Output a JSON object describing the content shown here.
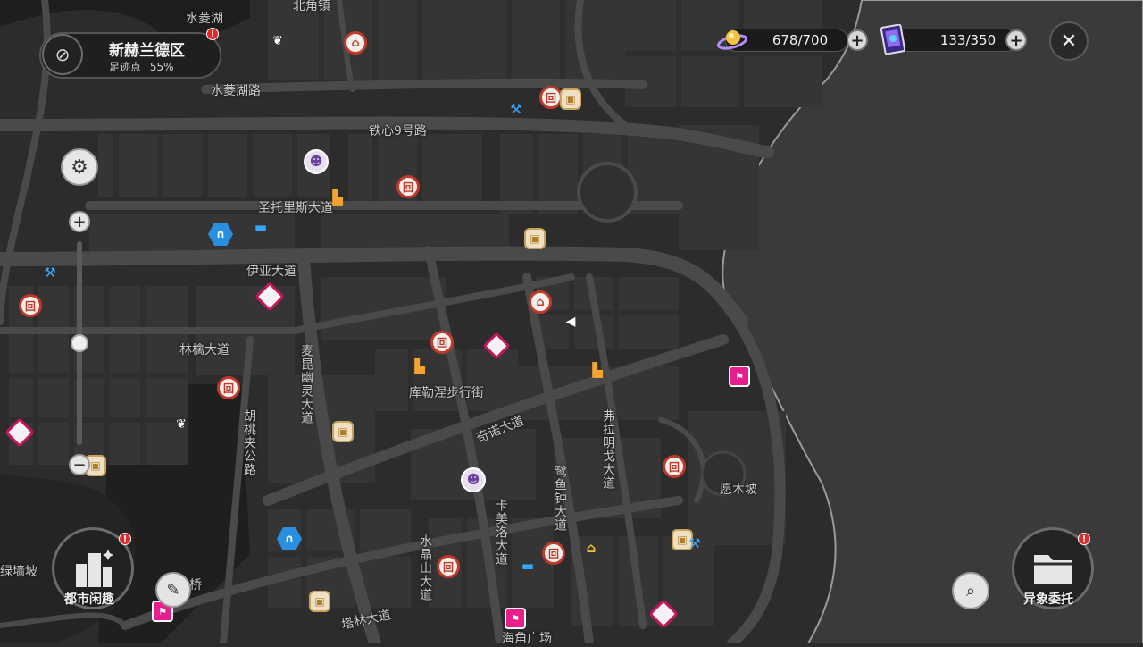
{
  "hud": {
    "district": {
      "name": "新赫兰德区",
      "progress_label": "足迹点",
      "progress_value": "55%"
    },
    "resources": [
      {
        "id": "energy",
        "value": "678/700",
        "icon": "energy-orb-icon"
      },
      {
        "id": "cards",
        "value": "133/350",
        "icon": "card-pack-icon"
      }
    ],
    "alert_mark": "!"
  },
  "bottom_left": {
    "city_fun_label": "都市闲趣"
  },
  "bottom_right": {
    "anomaly_label": "异象委托"
  },
  "map": {
    "labels": {
      "shuiling_lake": "水菱湖",
      "beijiao_town": "北角镇",
      "shuiling_lake_road": "水菱湖路",
      "tiexin_road": "铁心9号路",
      "santorius_ave": "圣托里斯大道",
      "yiya_ave": "伊亚大道",
      "linqin_ave": "林檎大道",
      "kulenie_street": "库勒涅步行街",
      "qinuo_ave": "奇诺大道",
      "maikun_ave": "麦昆幽灵大道",
      "hutao_road": "胡桃夹公路",
      "feilaming_ave": "弗拉明戈大道",
      "egret_ave": "鹭鱼钟大道",
      "kamei_ave": "卡美洛大道",
      "shuimiao_ave": "水晶山大道",
      "yuanmu_slope": "愿木坡",
      "green_wall_slope": "绿墙坡",
      "talin_ave": "塔林大道",
      "haijiao_plaza": "海角广场",
      "bridge": "桥"
    }
  }
}
